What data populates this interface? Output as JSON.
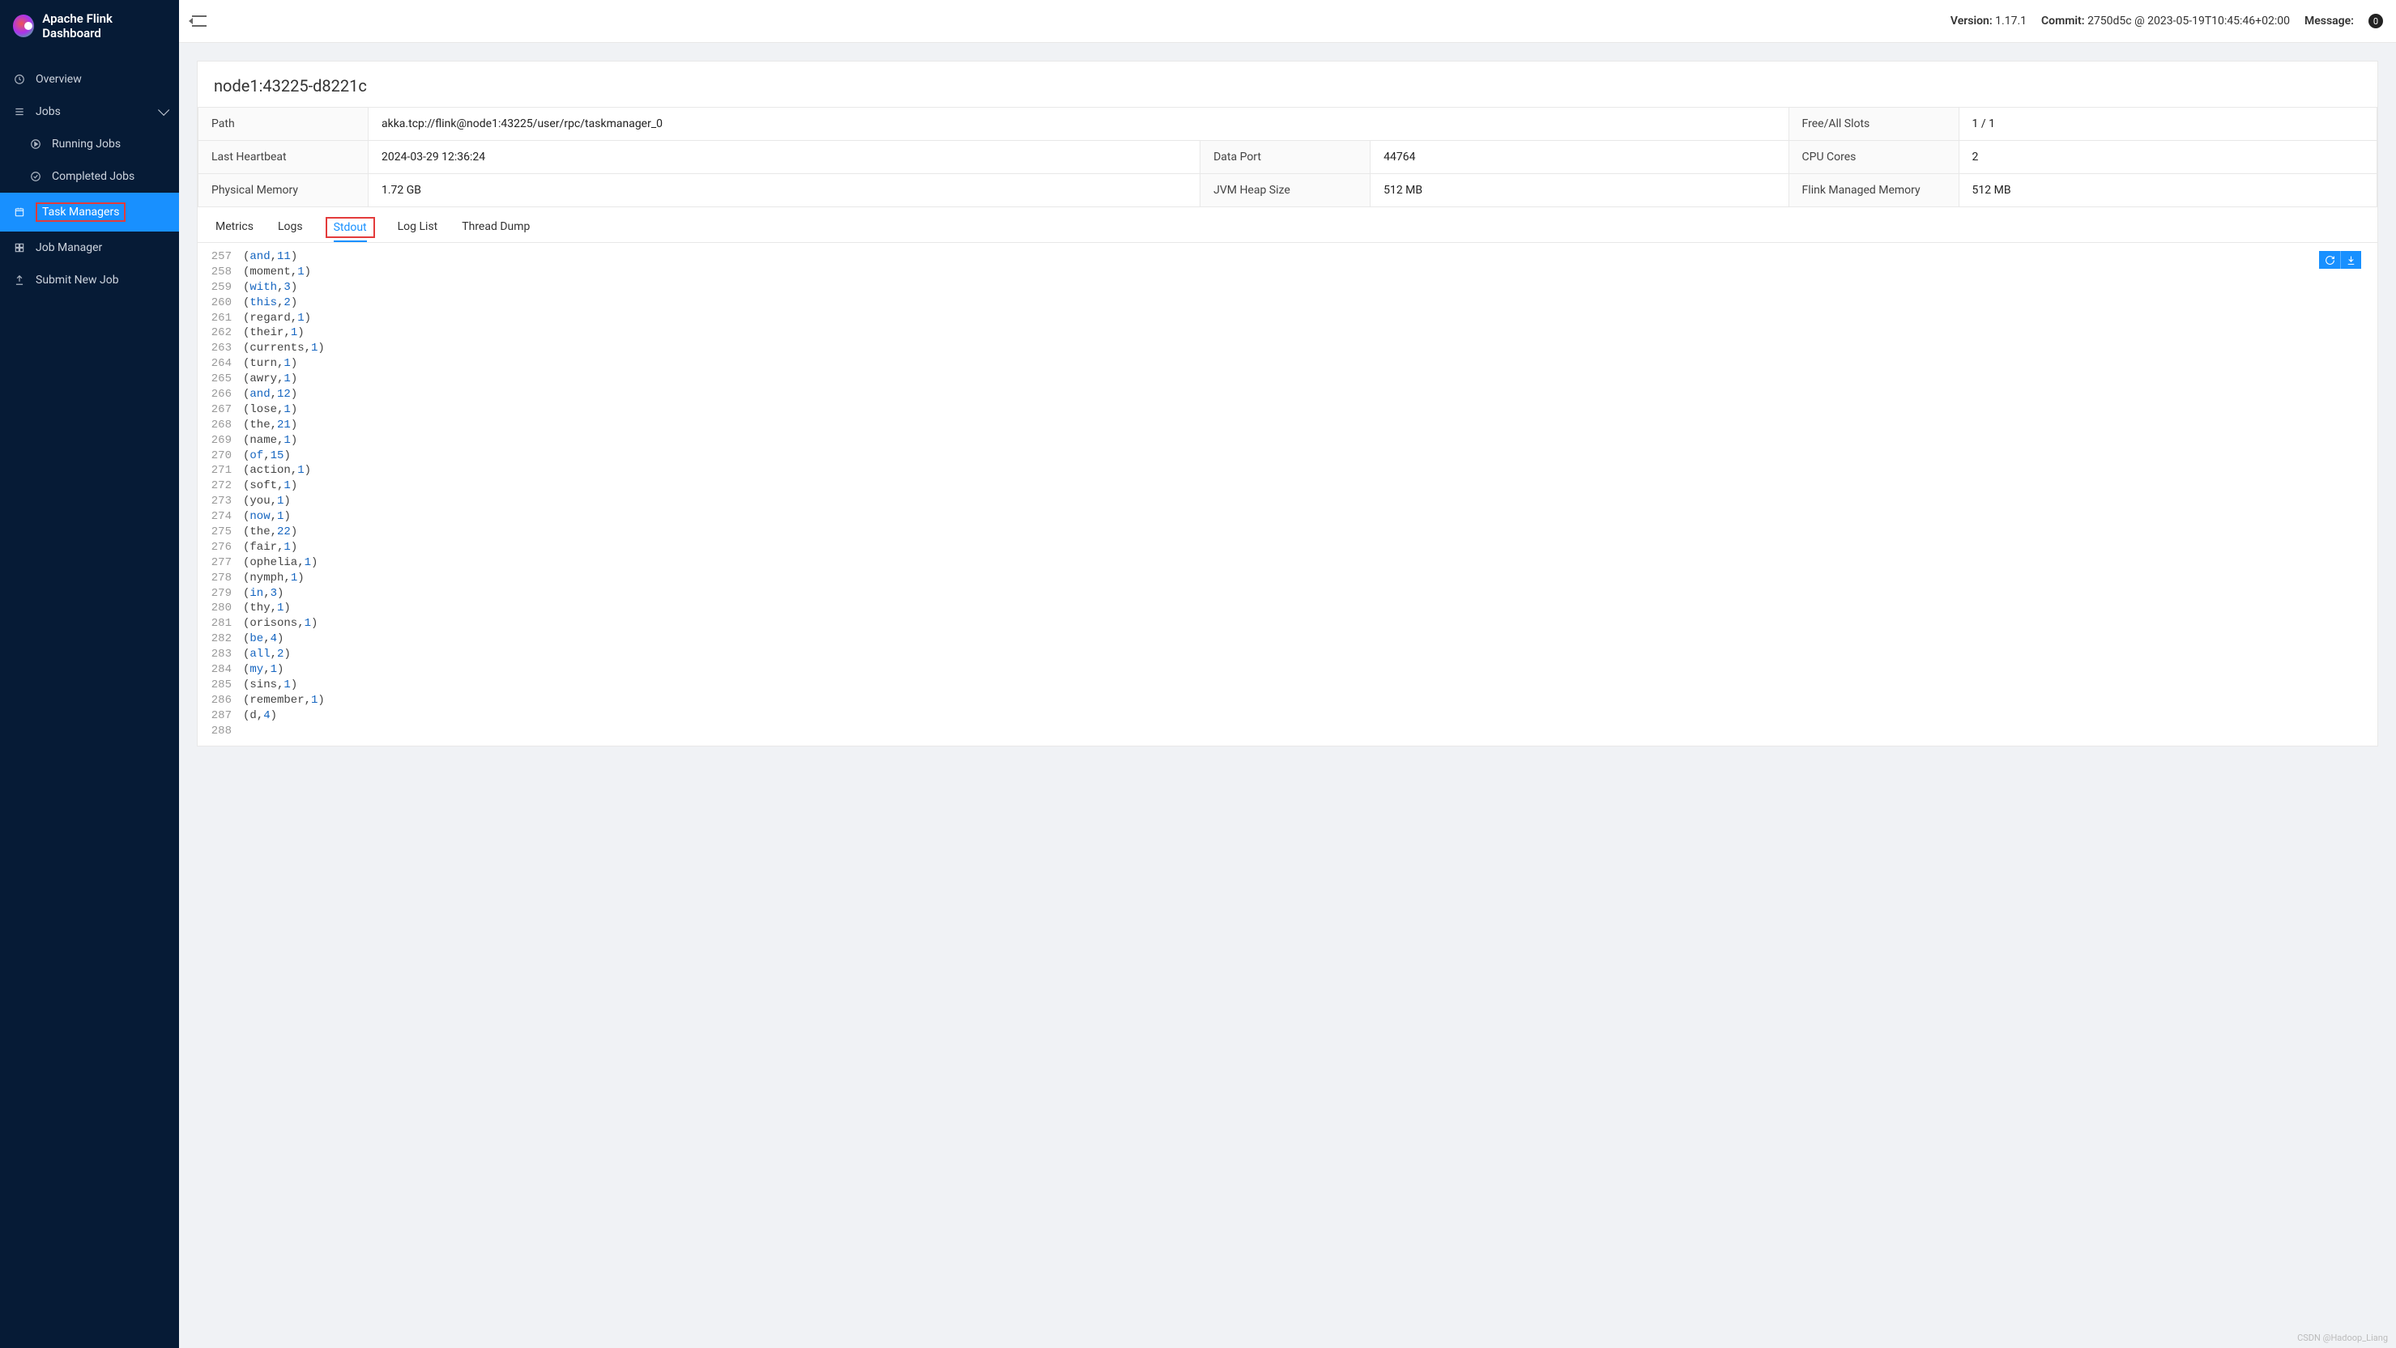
{
  "sidebar": {
    "title": "Apache Flink Dashboard",
    "items": {
      "overview": "Overview",
      "jobs": "Jobs",
      "running": "Running Jobs",
      "completed": "Completed Jobs",
      "task_managers": "Task Managers",
      "job_manager": "Job Manager",
      "submit": "Submit New Job"
    }
  },
  "topbar": {
    "version_label": "Version:",
    "version": "1.17.1",
    "commit_label": "Commit:",
    "commit": "2750d5c @ 2023-05-19T10:45:46+02:00",
    "message_label": "Message:",
    "badge": "0"
  },
  "page": {
    "title": "node1:43225-d8221c",
    "info": {
      "path_label": "Path",
      "path": "akka.tcp://flink@node1:43225/user/rpc/taskmanager_0",
      "slots_label": "Free/All Slots",
      "slots": "1 / 1",
      "hb_label": "Last Heartbeat",
      "hb": "2024-03-29 12:36:24",
      "port_label": "Data Port",
      "port": "44764",
      "cores_label": "CPU Cores",
      "cores": "2",
      "phys_label": "Physical Memory",
      "phys": "1.72 GB",
      "heap_label": "JVM Heap Size",
      "heap": "512 MB",
      "managed_label": "Flink Managed Memory",
      "managed": "512 MB"
    },
    "tabs": {
      "metrics": "Metrics",
      "logs": "Logs",
      "stdout": "Stdout",
      "loglist": "Log List",
      "thread": "Thread Dump"
    }
  },
  "stdout": [
    {
      "n": 257,
      "w": "and",
      "c": 11
    },
    {
      "n": 258,
      "w": "moment",
      "c": 1
    },
    {
      "n": 259,
      "w": "with",
      "c": 3
    },
    {
      "n": 260,
      "w": "this",
      "c": 2
    },
    {
      "n": 261,
      "w": "regard",
      "c": 1
    },
    {
      "n": 262,
      "w": "their",
      "c": 1
    },
    {
      "n": 263,
      "w": "currents",
      "c": 1
    },
    {
      "n": 264,
      "w": "turn",
      "c": 1
    },
    {
      "n": 265,
      "w": "awry",
      "c": 1
    },
    {
      "n": 266,
      "w": "and",
      "c": 12
    },
    {
      "n": 267,
      "w": "lose",
      "c": 1
    },
    {
      "n": 268,
      "w": "the",
      "c": 21
    },
    {
      "n": 269,
      "w": "name",
      "c": 1
    },
    {
      "n": 270,
      "w": "of",
      "c": 15
    },
    {
      "n": 271,
      "w": "action",
      "c": 1
    },
    {
      "n": 272,
      "w": "soft",
      "c": 1
    },
    {
      "n": 273,
      "w": "you",
      "c": 1
    },
    {
      "n": 274,
      "w": "now",
      "c": 1
    },
    {
      "n": 275,
      "w": "the",
      "c": 22
    },
    {
      "n": 276,
      "w": "fair",
      "c": 1
    },
    {
      "n": 277,
      "w": "ophelia",
      "c": 1
    },
    {
      "n": 278,
      "w": "nymph",
      "c": 1
    },
    {
      "n": 279,
      "w": "in",
      "c": 3
    },
    {
      "n": 280,
      "w": "thy",
      "c": 1
    },
    {
      "n": 281,
      "w": "orisons",
      "c": 1
    },
    {
      "n": 282,
      "w": "be",
      "c": 4
    },
    {
      "n": 283,
      "w": "all",
      "c": 2
    },
    {
      "n": 284,
      "w": "my",
      "c": 1
    },
    {
      "n": 285,
      "w": "sins",
      "c": 1
    },
    {
      "n": 286,
      "w": "remember",
      "c": 1
    },
    {
      "n": 287,
      "w": "d",
      "c": 4
    },
    {
      "n": 288,
      "w": "",
      "c": null
    }
  ],
  "watermark": "CSDN @Hadoop_Liang"
}
